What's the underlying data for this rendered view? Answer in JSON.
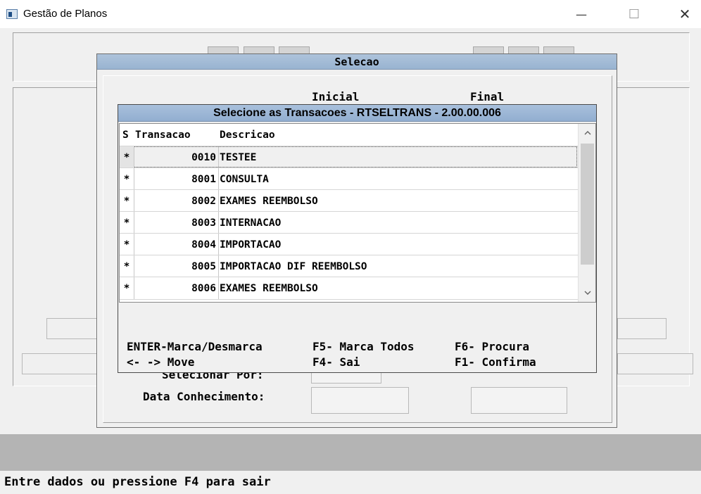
{
  "window": {
    "title": "Gestão de Planos",
    "minimize_glyph": "—",
    "maximize_glyph": "☐",
    "close_glyph": "✕"
  },
  "dialog": {
    "title": "Selecao",
    "col_inicial": "Inicial",
    "col_final": "Final",
    "field_selecionar_label": "Selecionar Por:",
    "field_data_conhecimento_label": "Data Conhecimento:"
  },
  "popup": {
    "title": "Selecione as Transacoes - RTSELTRANS - 2.00.00.006",
    "columns": [
      "S",
      "Transacao",
      "Descricao"
    ],
    "rows": [
      {
        "s": "*",
        "transacao": "0010",
        "descricao": "TESTEE"
      },
      {
        "s": "*",
        "transacao": "8001",
        "descricao": "CONSULTA"
      },
      {
        "s": "*",
        "transacao": "8002",
        "descricao": "EXAMES REEMBOLSO"
      },
      {
        "s": "*",
        "transacao": "8003",
        "descricao": "INTERNACAO"
      },
      {
        "s": "*",
        "transacao": "8004",
        "descricao": "IMPORTACAO"
      },
      {
        "s": "*",
        "transacao": "8005",
        "descricao": "IMPORTACAO DIF REEMBOLSO"
      },
      {
        "s": "*",
        "transacao": "8006",
        "descricao": "EXAMES REEMBOLSO"
      }
    ],
    "help": {
      "enter": "ENTER-Marca/Desmarca",
      "f5": "F5- Marca Todos",
      "f6": "F6- Procura",
      "move": "<- -> Move",
      "f4": "F4- Sai",
      "f1": "F1- Confirma"
    }
  },
  "status_bar": {
    "message": "Entre dados ou pressione F4 para sair"
  },
  "colors": {
    "title_bar_blue": "#99b4d1",
    "gray_band": "#b4b4b4"
  }
}
